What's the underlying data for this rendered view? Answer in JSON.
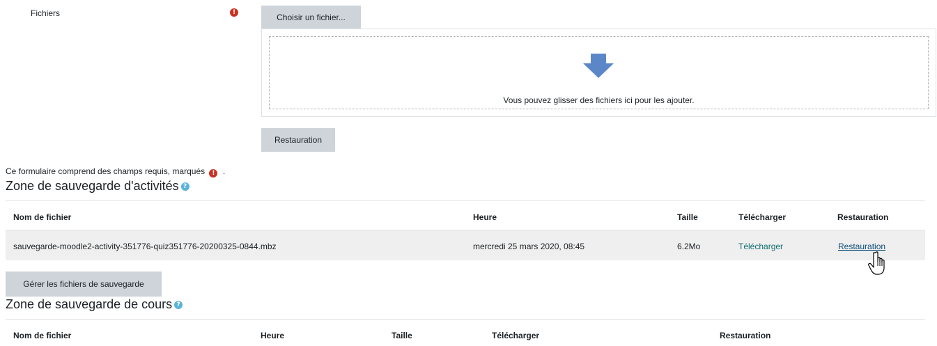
{
  "form": {
    "files_label": "Fichiers",
    "choose_file_button": "Choisir un fichier...",
    "drop_hint": "Vous pouvez glisser des fichiers ici pour les ajouter.",
    "restore_button": "Restauration",
    "required_note": "Ce formulaire comprend des champs requis, marqués",
    "required_note_suffix": ".",
    "required_icon_glyph": "!"
  },
  "activity_zone": {
    "title": "Zone de sauvegarde d'activités",
    "help_glyph": "?",
    "columns": [
      "Nom de fichier",
      "Heure",
      "Taille",
      "Télécharger",
      "Restauration"
    ],
    "rows": [
      {
        "filename": "sauvegarde-moodle2-activity-351776-quiz351776-20200325-0844.mbz",
        "time": "mercredi 25 mars 2020, 08:45",
        "size": "6.2Mo",
        "download": "Télécharger",
        "restore": "Restauration"
      }
    ],
    "manage_button": "Gérer les fichiers de sauvegarde"
  },
  "course_zone": {
    "title": "Zone de sauvegarde de cours",
    "help_glyph": "?",
    "columns": [
      "Nom de fichier",
      "Heure",
      "Taille",
      "Télécharger",
      "Restauration"
    ]
  },
  "colors": {
    "required": "#ca3120",
    "help": "#5bb3db",
    "button_bg": "#ced4da",
    "row_bg": "#efefef",
    "drop_arrow": "#5b87c9"
  },
  "icons": {
    "required": "exclamation-circle-icon",
    "help": "question-circle-icon",
    "drop": "arrow-down-icon",
    "cursor": "hand-pointer-icon"
  }
}
